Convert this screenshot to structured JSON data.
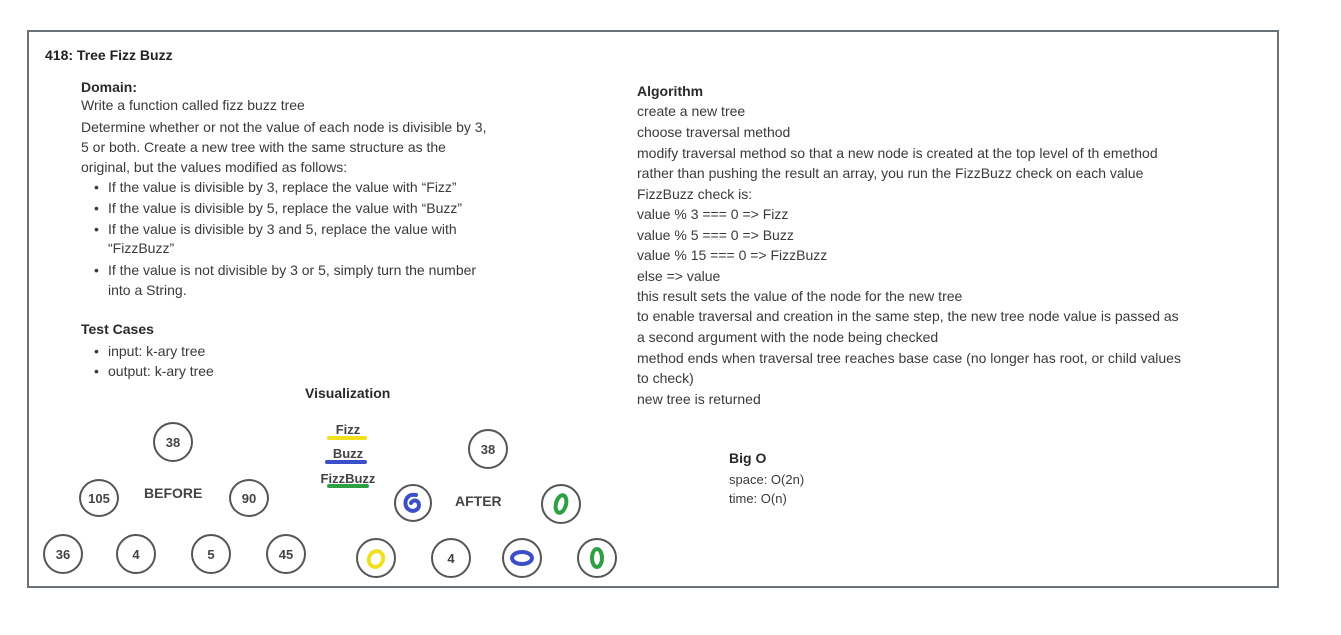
{
  "title": "418: Tree Fizz Buzz",
  "domain": {
    "heading": "Domain:",
    "lines": [
      "Write a function called fizz buzz tree",
      "Determine whether or not the value of each node is divisible by 3,",
      "5 or both. Create a new tree with the same structure as the",
      "original, but the values modified as follows:"
    ],
    "bullets": [
      "If the value is divisible by 3, replace the value with “Fizz”",
      "If the value is divisible by 5, replace the value with “Buzz”",
      "If the value is divisible by 3 and 5, replace the value with",
      "“FizzBuzz”",
      "If the value is not divisible by 3 or 5, simply turn the number",
      "into a String."
    ]
  },
  "test_cases": {
    "heading": "Test Cases",
    "items": [
      "input: k-ary tree",
      "output: k-ary tree"
    ]
  },
  "visualization": {
    "heading": "Visualization",
    "before_label": "BEFORE",
    "after_label": "AFTER",
    "before_nodes": [
      "38",
      "105",
      "90",
      "36",
      "4",
      "5",
      "45"
    ],
    "after_nodes": [
      "38",
      "4"
    ],
    "legend": [
      {
        "text": "Fizz",
        "color": "#f0e020"
      },
      {
        "text": "Buzz",
        "color": "#3b4fc9"
      },
      {
        "text": "FizzBuzz",
        "color": "#2ea043"
      }
    ]
  },
  "algorithm": {
    "heading": "Algorithm",
    "lines": [
      "create a new tree",
      "choose traversal method",
      "modify traversal method so that a new node is created at the top level of th emethod",
      "rather than pushing the result an array, you run the FizzBuzz check on each value",
      "FizzBuzz check is:",
      "value % 3 === 0 => Fizz",
      "value % 5 === 0 => Buzz",
      "value % 15 === 0 => FizzBuzz",
      "else => value",
      "this result sets the value of the node for the new tree",
      "to enable traversal and creation in the same step, the new tree node value is passed as",
      "a second argument with the node being checked",
      "method ends when traversal tree reaches base case (no longer has root, or child values",
      "to check)",
      "new tree is returned"
    ]
  },
  "big_o": {
    "heading": "Big O",
    "space": "space: O(2n)",
    "time": "time: O(n)"
  }
}
